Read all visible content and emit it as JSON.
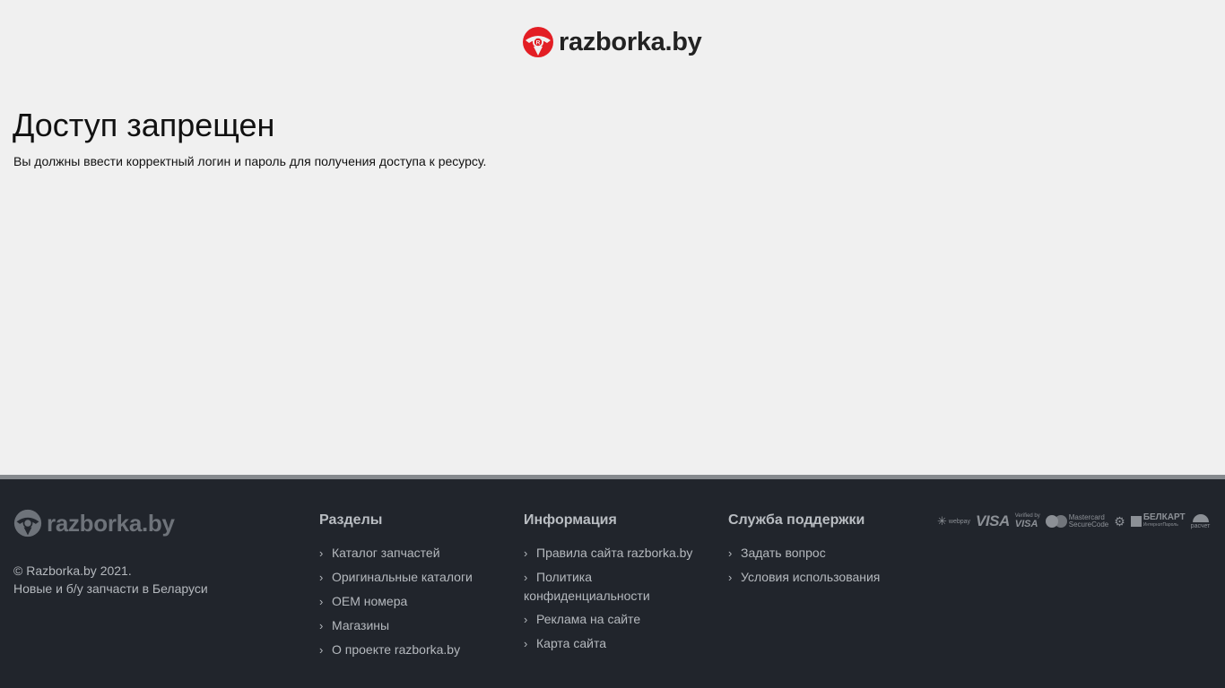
{
  "header": {
    "logo_text": "razborka.by",
    "logo_icon": "steering-wheel-logo-icon",
    "logo_color": "#e31e24"
  },
  "main": {
    "title": "Доступ запрещен",
    "message": "Вы должны ввести корректный логин и пароль для получения доступа к ресурсу."
  },
  "footer": {
    "logo_text": "razborka.by",
    "copyright_line1": "© Razborka.by 2021.",
    "copyright_line2": "Новые и б/у запчасти в Беларуси",
    "background_color": "#21252c",
    "columns": [
      {
        "title": "Разделы",
        "links": [
          "Каталог запчастей",
          "Оригинальные каталоги",
          "OEM номера",
          "Магазины",
          "О проекте razborka.by"
        ]
      },
      {
        "title": "Информация",
        "links": [
          "Правила сайта razborka.by",
          "Политика конфиденциальности",
          "Реклама на сайте",
          "Карта сайта"
        ]
      },
      {
        "title": "Служба поддержки",
        "links": [
          "Задать вопрос",
          "Условия использования"
        ]
      }
    ],
    "chevron": "›",
    "payments": {
      "webpay": "webpay",
      "visa": "VISA",
      "verified_by_small": "Verified by",
      "verified_by_visa": "VISA",
      "mastercard_line1": "Mastercard",
      "mastercard_line2": "SecureCode",
      "belkart_line1": "БЕЛКАРТ",
      "belkart_line2": "ИнтернэтПароль",
      "raschet": "расчет"
    }
  }
}
